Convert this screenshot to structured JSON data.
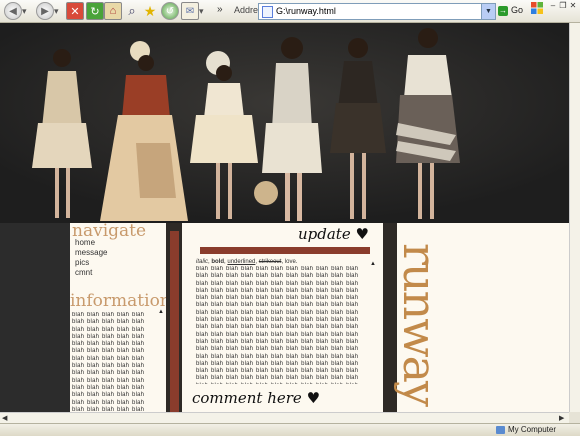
{
  "browser": {
    "forward_chevron": "»",
    "address_label": "Address",
    "address_value": "G:\\runway.html",
    "go_label": "Go",
    "status_zone": "My Computer"
  },
  "icons": [
    "back-icon",
    "forward-icon",
    "stop-icon",
    "refresh-icon",
    "home-icon",
    "search-icon",
    "favorites-icon",
    "history-icon",
    "mail-icon",
    "page-icon",
    "go-arrow-icon",
    "windows-logo-icon",
    "computer-icon"
  ],
  "page": {
    "nav_heading": "navigate",
    "nav_links": [
      "home",
      "message",
      "pics",
      "cmnt"
    ],
    "info_heading": "information",
    "info_text": "blah blah blah blah blah blah blah blah blah blah blah blah blah blah blah blah blah blah blah blah blah blah blah blah blah blah blah blah blah blah blah blah blah blah blah blah blah blah blah blah blah blah blah blah blah blah blah blah blah blah blah blah blah blah blah blah blah blah blah blah blah blah blah blah blah blah blah blah blah blah blah blah blah blah blah blah blah blah blah blah blah blah blah blah blah blah blah blah blah blah blah blah blah blah blah blah blah blah blah blah blah blah blah blah blah blah blah blah blah blah blah blah blah blah blah blah blah blah blah blah blah blah blah blah blah blah blah blah blah blah blah blah blah blah",
    "update_heading": "update ♥",
    "style_sample": {
      "italic": "italic",
      "bold": "bold",
      "underlined": "underlined",
      "strikeout": "strikeout",
      "love": "love"
    },
    "update_text": "blah blah blah blah blah blah blah blah blah blah blah blah blah blah blah blah blah blah blah blah blah blah blah blah blah blah blah blah blah blah blah blah blah blah blah blah blah blah blah blah blah blah blah blah blah blah blah blah blah blah blah blah blah blah blah blah blah blah blah blah blah blah blah blah blah blah blah blah blah blah blah blah blah blah blah blah blah blah blah blah blah blah blah blah blah blah blah blah blah blah blah blah blah blah blah blah blah blah blah blah blah blah blah blah blah blah blah blah blah blah blah blah blah blah blah blah blah blah blah blah blah blah blah blah blah blah blah blah blah blah blah blah blah blah blah blah blah blah blah blah blah blah blah blah blah blah blah blah blah blah blah blah blah blah blah blah blah blah blah blah blah blah blah blah blah blah blah blah blah blah blah blah blah blah blah blah blah blah blah blah blah blah blah blah blah blah blah blah blah blah blah blah blah blah blah blah blah blah blah blah blah blah blah blah blah blah blah blah blah blah blah blah blah blah blah blah blah blah blah",
    "comment_heading": "comment here ♥",
    "side_title": "runway"
  },
  "colors": {
    "accent": "#8a3c2c",
    "heading": "#c89a6c",
    "side_title": "#c28a4a",
    "page_bg": "#fdf9f0",
    "dark_bg": "#2c2c2c"
  }
}
